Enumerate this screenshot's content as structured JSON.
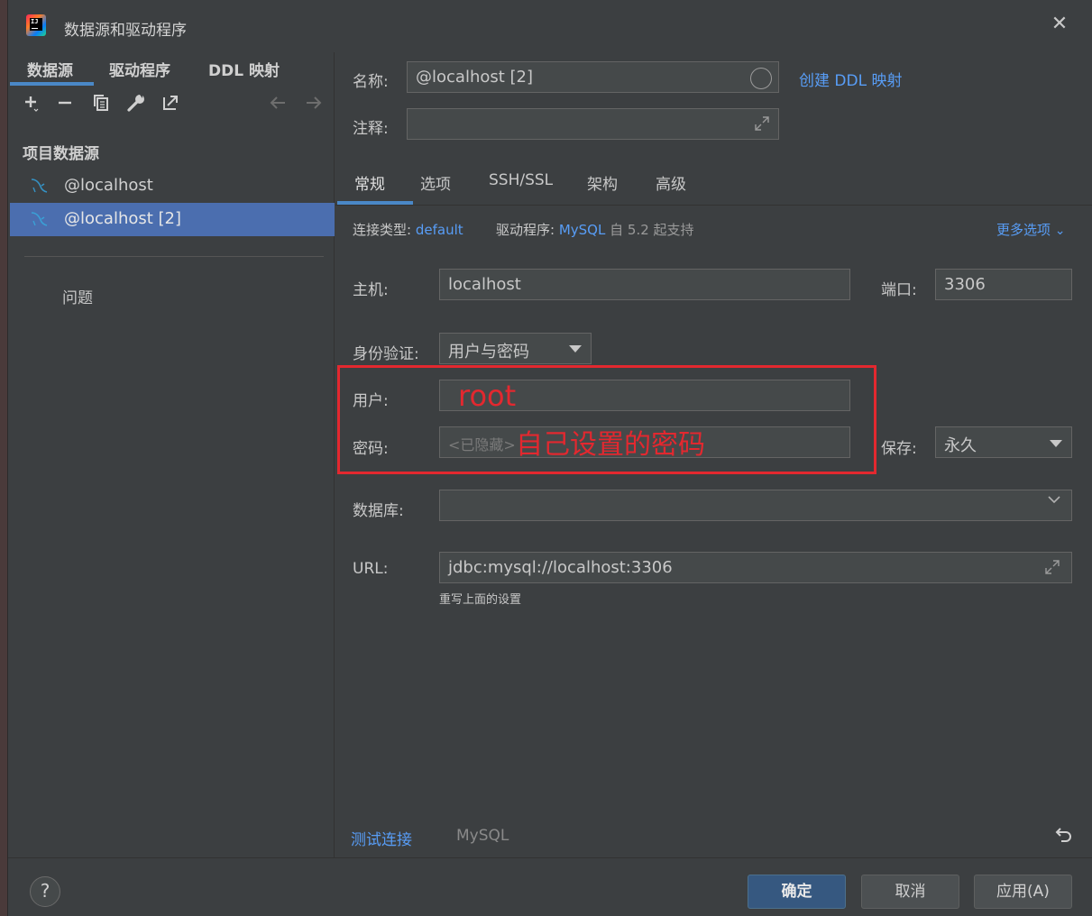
{
  "window": {
    "title": "数据源和驱动程序"
  },
  "left": {
    "tabs": [
      "数据源",
      "驱动程序",
      "DDL 映射"
    ],
    "section_title": "项目数据源",
    "items": [
      {
        "label": "@localhost",
        "selected": false
      },
      {
        "label": "@localhost [2]",
        "selected": true
      }
    ],
    "problems_label": "问题"
  },
  "form": {
    "name_label": "名称:",
    "name_value": "@localhost [2]",
    "create_ddl_link": "创建 DDL 映射",
    "comment_label": "注释:",
    "comment_value": "",
    "tabs": [
      "常规",
      "选项",
      "SSH/SSL",
      "架构",
      "高级"
    ],
    "conn_type_label": "连接类型:",
    "conn_type_value": "default",
    "driver_label": "驱动程序:",
    "driver_value": "MySQL",
    "driver_note": "自 5.2 起支持",
    "more_options": "更多选项",
    "host_label": "主机:",
    "host_value": "localhost",
    "port_label": "端口:",
    "port_value": "3306",
    "auth_label": "身份验证:",
    "auth_value": "用户与密码",
    "user_label": "用户:",
    "user_value": "",
    "password_label": "密码:",
    "password_placeholder": "<已隐藏>",
    "save_label": "保存:",
    "save_value": "永久",
    "database_label": "数据库:",
    "database_value": "",
    "url_label": "URL:",
    "url_value": "jdbc:mysql://localhost:3306",
    "url_hint": "重写上面的设置",
    "test_connection": "测试连接",
    "driver_footer": "MySQL"
  },
  "annotations": {
    "user_note": "root",
    "password_note": "自己设置的密码",
    "color": "#e3282f"
  },
  "footer": {
    "help": "?",
    "ok": "确定",
    "cancel": "取消",
    "apply": "应用(A)"
  },
  "colors": {
    "accent": "#589df6",
    "selection": "#4b6eaf",
    "primary_button": "#365880"
  }
}
